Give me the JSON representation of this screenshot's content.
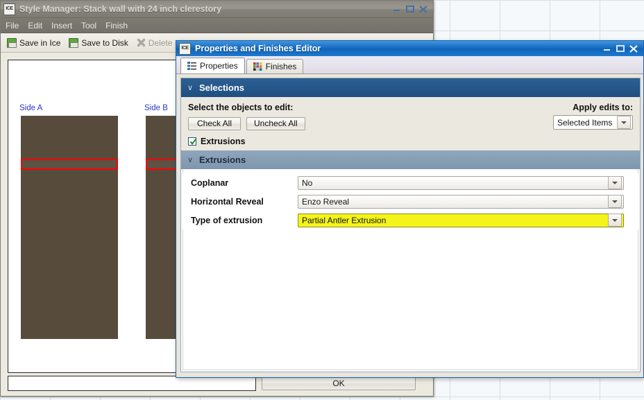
{
  "desktop": {
    "background_color": "#f5f9fc",
    "gridline_color": "#d7dde3"
  },
  "style_manager": {
    "title": "Style Manager: Stack wall with 24 inch clerestory",
    "logo_text": "ICE",
    "menu": [
      "File",
      "Edit",
      "Insert",
      "Tool",
      "Finish"
    ],
    "toolbar": [
      {
        "label": "Save in Ice",
        "icon": "save-icon",
        "disabled": false
      },
      {
        "label": "Save to Disk",
        "icon": "save-icon",
        "disabled": false
      },
      {
        "label": "Delete",
        "icon": "delete-x-icon",
        "disabled": true
      }
    ],
    "window_buttons": [
      "minimize",
      "maximize",
      "close"
    ],
    "preview": {
      "panel_color": "#574c3c",
      "reveal_color": "#ff0000",
      "items": [
        {
          "label": "Side A"
        },
        {
          "label": "Side B"
        }
      ]
    },
    "ok_label": "OK",
    "text_field_value": ""
  },
  "properties_dialog": {
    "title": "Properties and Finishes Editor",
    "logo_text": "ICE",
    "window_buttons": [
      "minimize",
      "maximize",
      "close"
    ],
    "tabs": [
      {
        "label": "Properties",
        "icon": "list-icon",
        "active": true
      },
      {
        "label": "Finishes",
        "icon": "color-swatch-icon",
        "active": false
      }
    ],
    "selections": {
      "header": "Selections",
      "chevron": "∨",
      "prompt": "Select the objects to edit:",
      "check_all_label": "Check All",
      "uncheck_all_label": "Uncheck All",
      "apply_label": "Apply edits to:",
      "apply_value": "Selected Items",
      "checkboxes": [
        {
          "label": "Extrusions",
          "checked": true
        }
      ]
    },
    "extrusions": {
      "header": "Extrusions",
      "chevron": "∨",
      "fields": [
        {
          "label": "Coplanar",
          "value": "No",
          "highlighted": false
        },
        {
          "label": "Horizontal Reveal",
          "value": "Enzo Reveal",
          "highlighted": false
        },
        {
          "label": "Type of extrusion",
          "value": "Partial Antler Extrusion",
          "highlighted": true
        }
      ]
    },
    "accent_color": "#1b6fc4",
    "section_header_color": "#2c5f93",
    "highlight_color": "#f4f41a"
  }
}
